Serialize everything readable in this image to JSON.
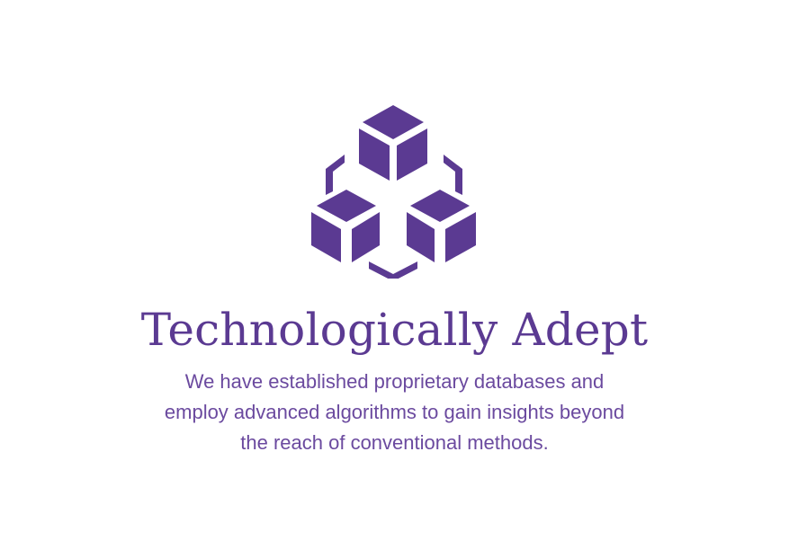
{
  "colors": {
    "primary": "#5b3a92",
    "text": "#6b4a9f",
    "background": "#ffffff"
  },
  "logo": {
    "icon": "three-cubes-network-icon"
  },
  "heading": {
    "title": "Technologically Adept"
  },
  "description": {
    "line1": "We have established proprietary databases and",
    "line2": "employ advanced algorithms to gain insights beyond",
    "line3": "the reach of conventional methods."
  }
}
